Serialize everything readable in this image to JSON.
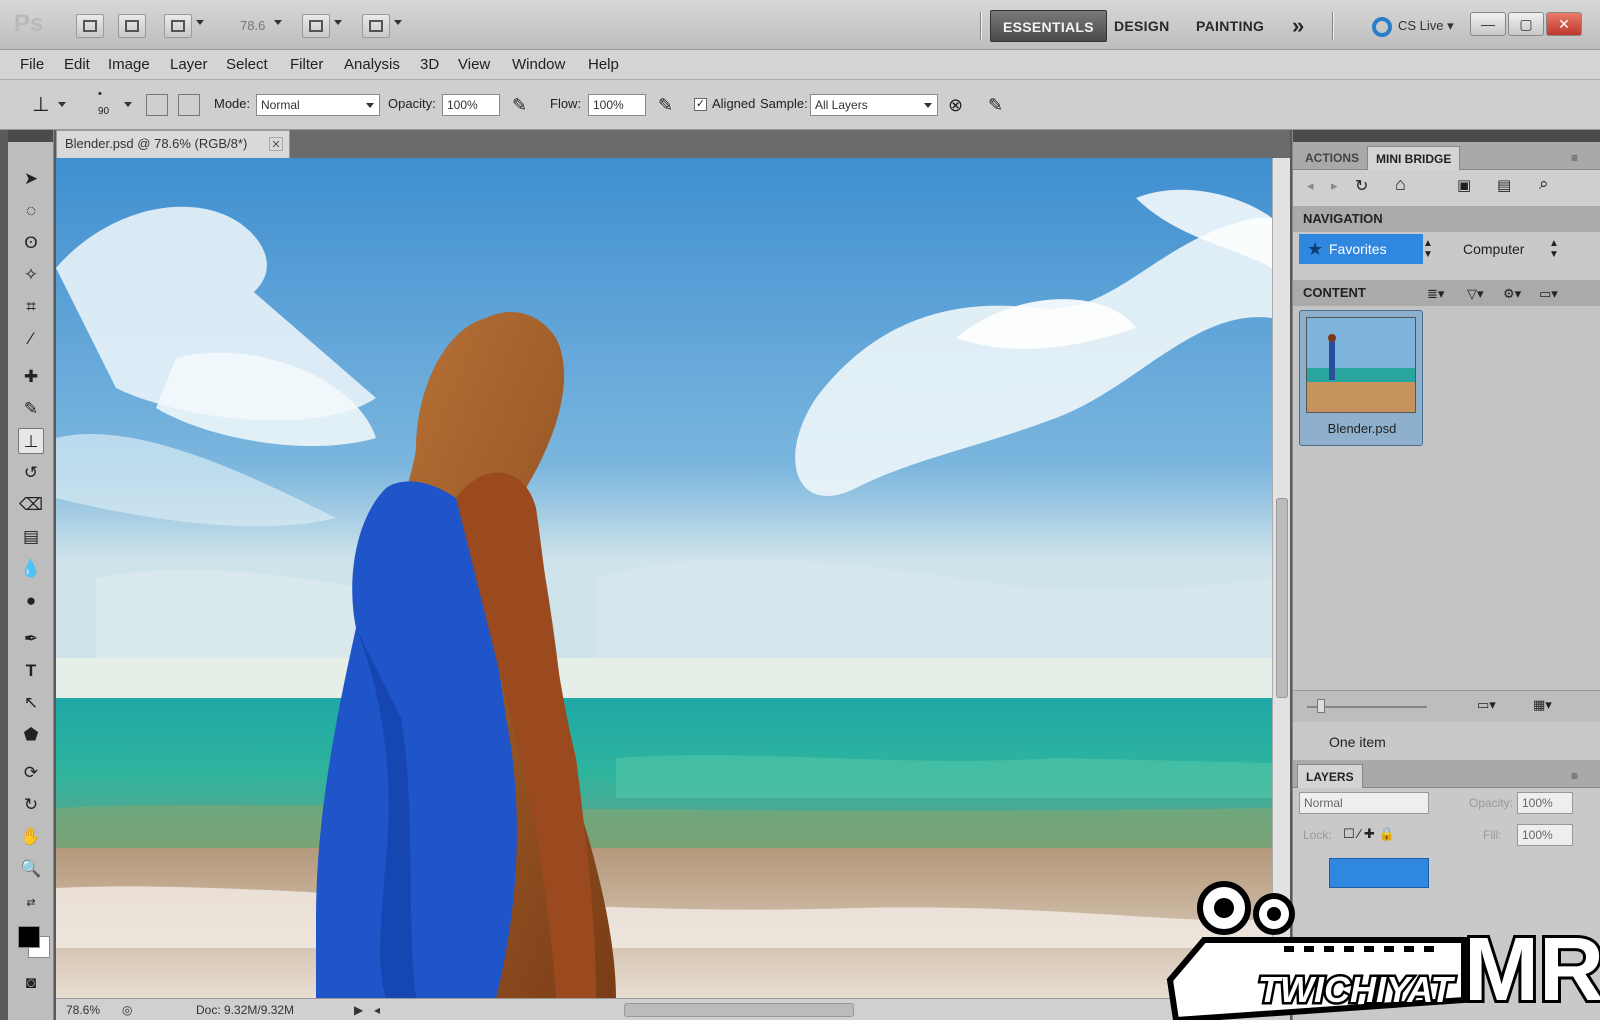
{
  "app": {
    "logo_text": "Ps",
    "zoom_display": "78.6",
    "workspaces": [
      "ESSENTIALS",
      "DESIGN",
      "PAINTING"
    ],
    "workspace_overflow": "»",
    "cs_live": "CS Live"
  },
  "menu": [
    "File",
    "Edit",
    "Image",
    "Layer",
    "Select",
    "Filter",
    "Analysis",
    "3D",
    "View",
    "Window",
    "Help"
  ],
  "options": {
    "brush_size": "90",
    "mode_label": "Mode:",
    "mode_value": "Normal",
    "opacity_label": "Opacity:",
    "opacity_value": "100%",
    "flow_label": "Flow:",
    "flow_value": "100%",
    "aligned_label": "Aligned",
    "aligned_checked": "✓",
    "sample_label": "Sample:",
    "sample_value": "All Layers"
  },
  "document": {
    "tab_title": "Blender.psd @ 78.6% (RGB/8*)",
    "status_zoom": "78.6%",
    "status_doc": "Doc: 9.32M/9.32M"
  },
  "panel": {
    "tabs": [
      "ACTIONS",
      "MINI BRIDGE"
    ],
    "navigation_title": "NAVIGATION",
    "favorites": "Favorites",
    "computer": "Computer",
    "content_title": "CONTENT",
    "thumb_label": "Blender.psd",
    "item_count": "One item",
    "layers_tab": "LAYERS",
    "blend_mode": "Normal",
    "opacity_label": "Opacity:",
    "opacity_value": "100%",
    "lock_label": "Lock:",
    "fill_label": "Fill:",
    "fill_value": "100%"
  },
  "watermark": {
    "text_main": "TWICHIYAT",
    "text_right": "MR"
  },
  "colors": {
    "accent_blue": "#2f87e0",
    "foreground": "#000000",
    "background": "#ffffff"
  }
}
